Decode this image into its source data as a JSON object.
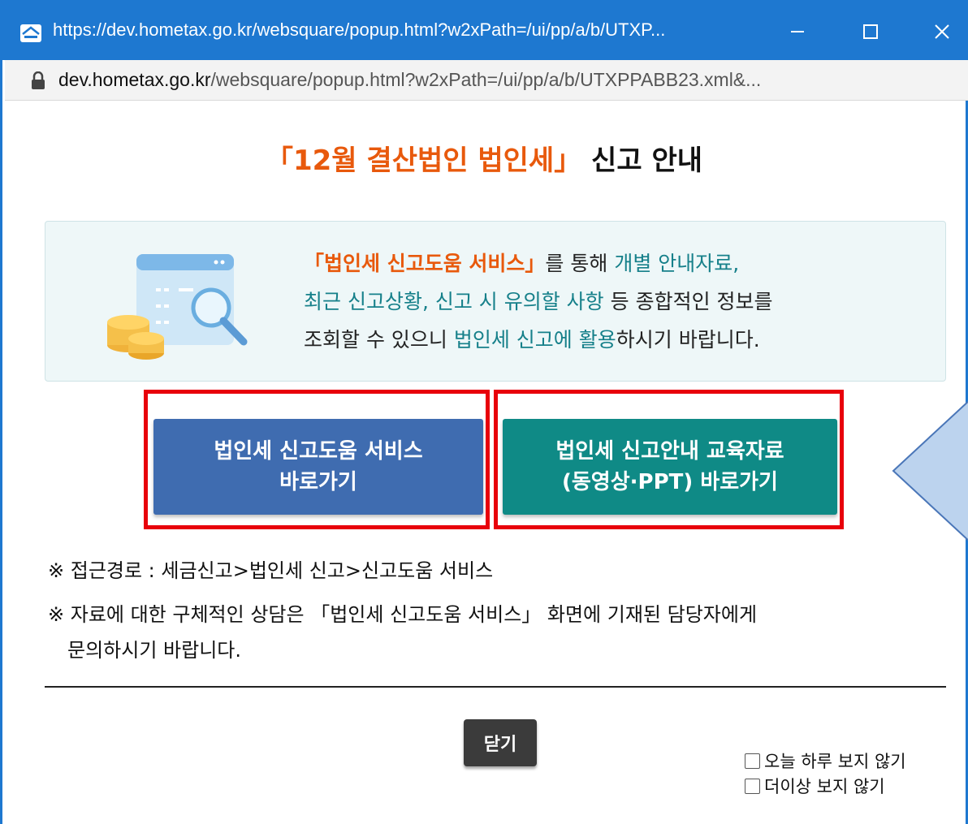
{
  "window": {
    "title": "https://dev.hometax.go.kr/websquare/popup.html?w2xPath=/ui/pp/a/b/UTXP...",
    "address_host": "dev.hometax.go.kr",
    "address_path": "/websquare/popup.html?w2xPath=/ui/pp/a/b/UTXPPABB23.xml&..."
  },
  "heading": {
    "highlight": "「12월 결산법인 법인세」",
    "rest": " 신고 안내"
  },
  "info": {
    "line1_a": "「법인세 신고도움 서비스」",
    "line1_b": "를 통해 ",
    "line1_c": "개별 안내자료,",
    "line2_a": "최근 신고상황, 신고 시 유의할 사항",
    "line2_b": " 등 종합적인 정보를",
    "line3_a": "조회할 수 있으니 ",
    "line3_b": "법인세 신고에 활용",
    "line3_c": "하시기 바랍니다."
  },
  "buttons": {
    "help_line1": "법인세 신고도움 서비스",
    "help_line2": "바로가기",
    "edu_line1": "법인세 신고안내 교육자료",
    "edu_line2": "(동영상·PPT) 바로가기",
    "close": "닫기"
  },
  "notes": {
    "path": "※ 접근경로 : 세금신고>법인세 신고>신고도움 서비스",
    "consult_line1": "※ 자료에 대한 구체적인 상담은 「법인세 신고도움 서비스」 화면에 기재된 담당자에게",
    "consult_line2": "문의하시기 바랍니다."
  },
  "options": {
    "today": "오늘 하루 보지 않기",
    "never": "더이상 보지 않기"
  },
  "colors": {
    "titlebar": "#1e78d0",
    "accent_orange": "#e8590c",
    "accent_teal": "#16808a",
    "help_button": "#3f6cb0",
    "edu_button": "#0f8a86",
    "highlight_frame": "#e8000b"
  }
}
